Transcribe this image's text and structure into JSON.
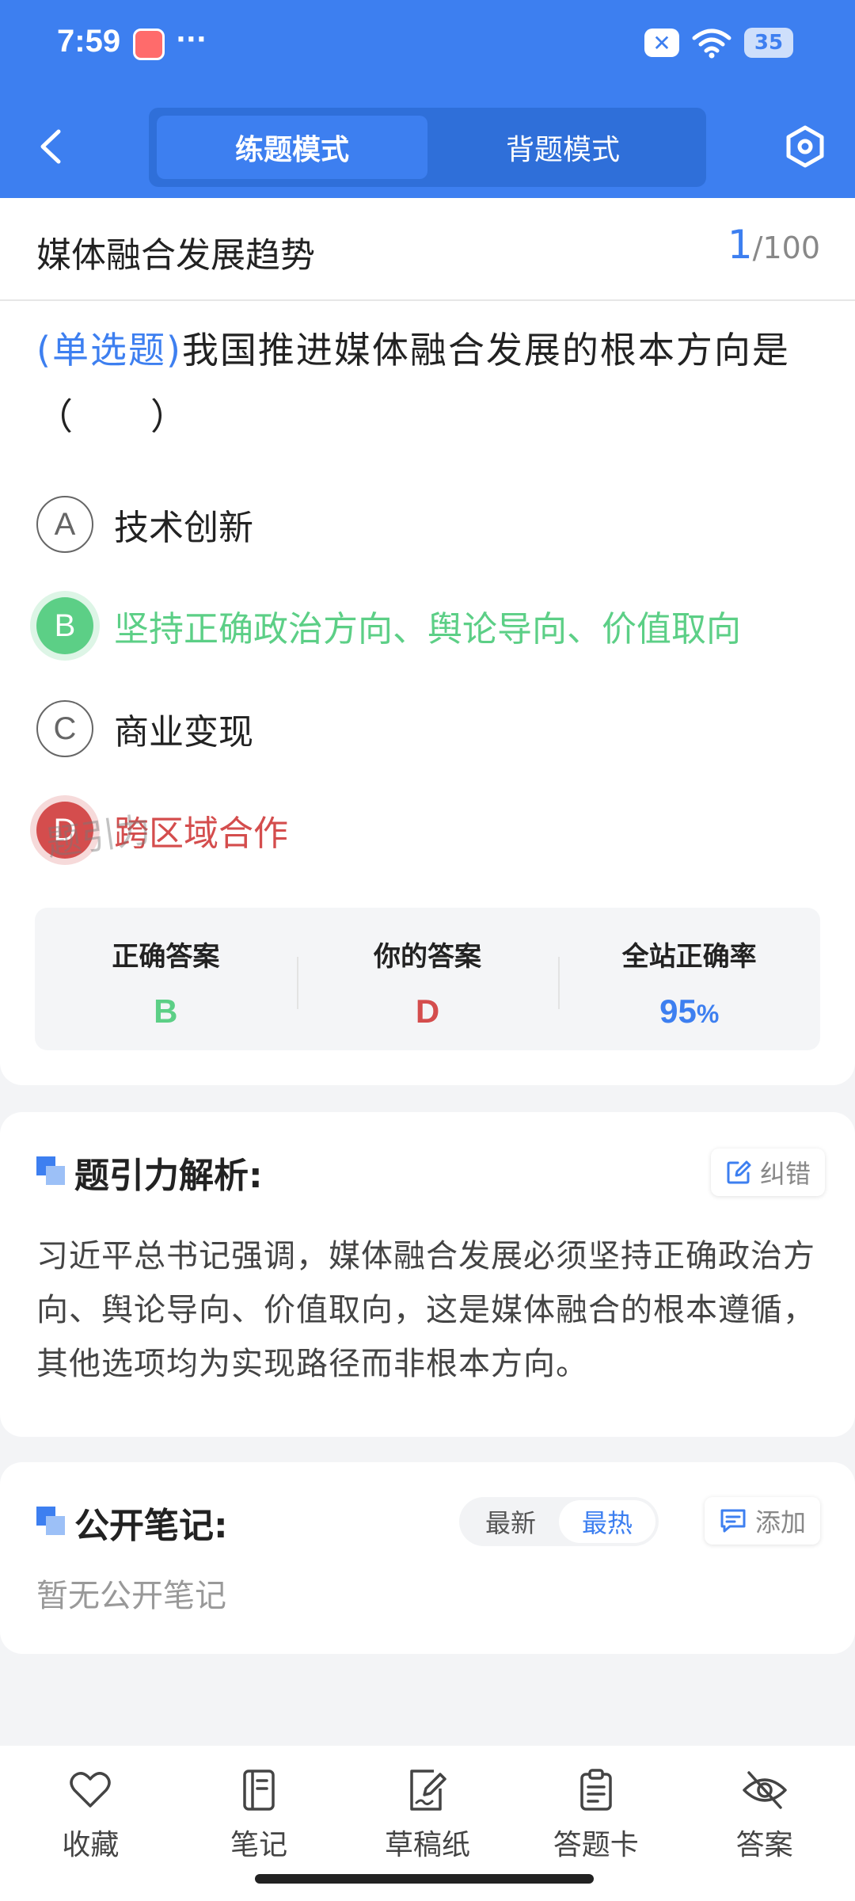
{
  "status_bar": {
    "time": "7:59",
    "more": "···",
    "close_glyph": "✕",
    "battery": "35"
  },
  "header": {
    "tabs": [
      {
        "label": "练题模式",
        "active": true
      },
      {
        "label": "背题模式",
        "active": false
      }
    ]
  },
  "topic": {
    "title": "媒体融合发展趋势",
    "current": "1",
    "total": "/100"
  },
  "question": {
    "type": "(单选题)",
    "text": "我国推进媒体融合发展的根本方向是（　　）"
  },
  "options": [
    {
      "letter": "A",
      "text": "技术创新",
      "state": "normal"
    },
    {
      "letter": "B",
      "text": "坚持正确政治方向、舆论导向、价值取向",
      "state": "correct"
    },
    {
      "letter": "C",
      "text": "商业变现",
      "state": "normal"
    },
    {
      "letter": "D",
      "text": "跨区域合作",
      "state": "wrong"
    }
  ],
  "stats": {
    "correct_label": "正确答案",
    "correct_value": "B",
    "yours_label": "你的答案",
    "yours_value": "D",
    "rate_label": "全站正确率",
    "rate_value": "95",
    "rate_unit": "%"
  },
  "watermark": "题引力",
  "analysis": {
    "title": "题引力解析:",
    "report_label": "纠错",
    "text": "习近平总书记强调，媒体融合发展必须坚持正确政治方向、舆论导向、价值取向，这是媒体融合的根本遵循，其他选项均为实现路径而非根本方向。"
  },
  "notes": {
    "title": "公开笔记:",
    "sort_options": [
      "最新",
      "最热"
    ],
    "sort_active": "最热",
    "add_label": "添加",
    "empty_text": "暂无公开笔记"
  },
  "bottom_nav": [
    {
      "label": "收藏",
      "icon": "heart-icon"
    },
    {
      "label": "笔记",
      "icon": "notebook-icon"
    },
    {
      "label": "草稿纸",
      "icon": "draft-pen-icon"
    },
    {
      "label": "答题卡",
      "icon": "clipboard-icon"
    },
    {
      "label": "答案",
      "icon": "eye-off-icon"
    }
  ],
  "colors": {
    "primary": "#3d7ff0",
    "correct": "#5ccf86",
    "wrong": "#d44d4d"
  }
}
